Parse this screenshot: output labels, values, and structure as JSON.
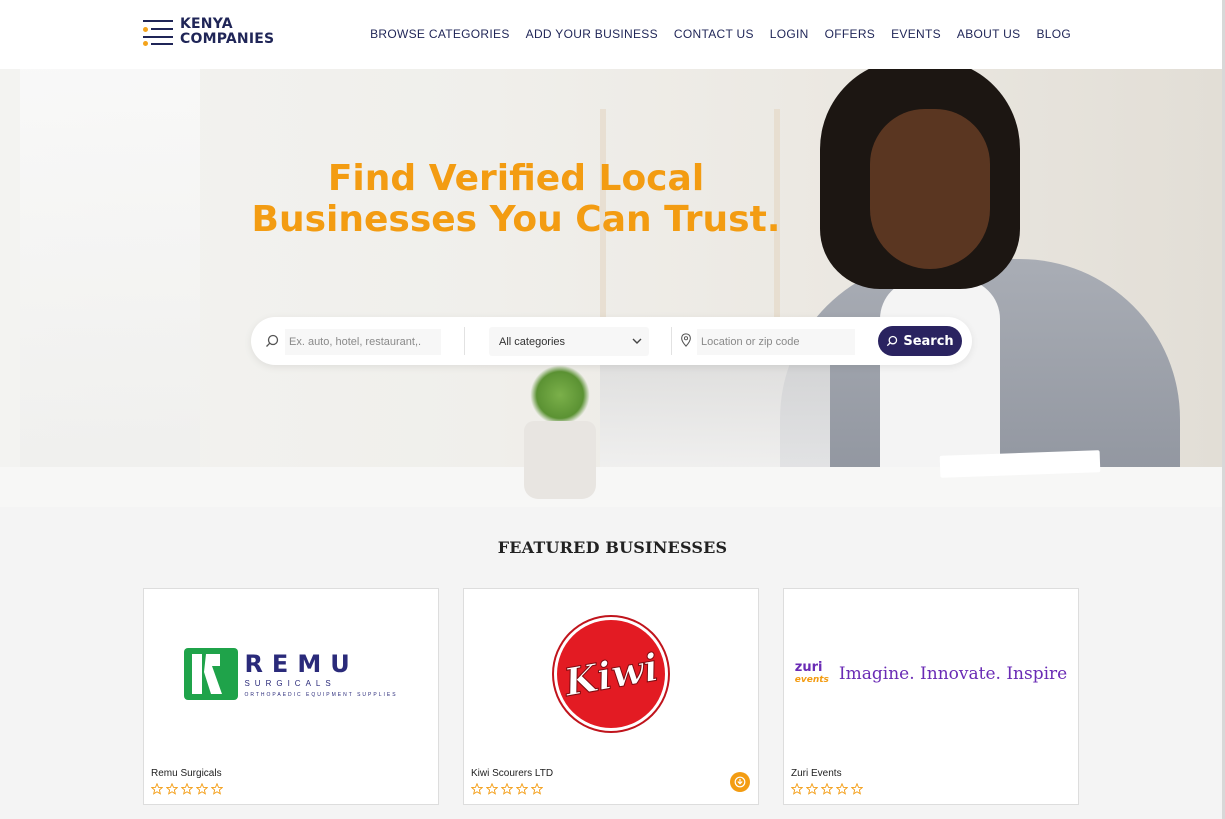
{
  "brand": {
    "line1": "KENYA",
    "line2": "COMPANIES"
  },
  "nav": [
    "BROWSE CATEGORIES",
    "ADD YOUR BUSINESS",
    "CONTACT US",
    "LOGIN",
    "OFFERS",
    "EVENTS",
    "ABOUT US",
    "BLOG"
  ],
  "hero": {
    "title_line1": "Find Verified Local",
    "title_line2": "Businesses You Can Trust."
  },
  "search": {
    "keyword_placeholder": "Ex. auto, hotel, restaurant,.",
    "category_value": "All categories",
    "location_placeholder": "Location or zip code",
    "button_label": "Search"
  },
  "featured": {
    "title": "FEATURED BUSINESSES",
    "cards": [
      {
        "name": "Remu Surgicals",
        "logo_word": "REMU",
        "logo_sub": "SURGICALS",
        "logo_tiny": "ORTHOPAEDIC EQUIPMENT SUPPLIES",
        "rating": 0
      },
      {
        "name": "Kiwi Scourers LTD",
        "logo_word": "Kiwi",
        "rating": 0
      },
      {
        "name": "Zuri Events",
        "logo_word": "zuri",
        "logo_sub": "events",
        "tagline": "Imagine. Innovate. Inspire",
        "rating": 0
      }
    ]
  },
  "colors": {
    "accent": "#f39c12",
    "navy": "#1f2557",
    "button": "#2a2360"
  }
}
